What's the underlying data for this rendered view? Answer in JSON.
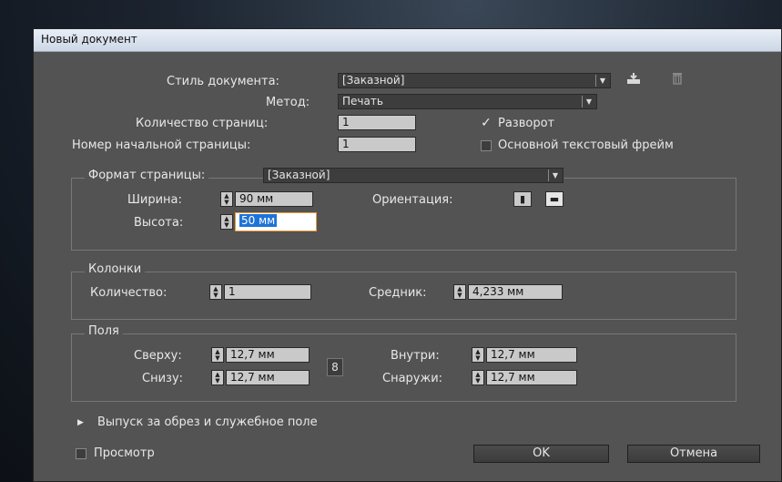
{
  "window": {
    "title": "Новый документ"
  },
  "doc": {
    "style_label": "Стиль документа:",
    "style_value": "[Заказной]",
    "method_label": "Метод:",
    "method_value": "Печать",
    "pages_label": "Количество страниц:",
    "pages_value": "1",
    "start_label": "Номер начальной страницы:",
    "start_value": "1",
    "spread_label": "Разворот",
    "spread_checked": true,
    "master_label": "Основной текстовый фрейм",
    "master_checked": false,
    "save_icon": "save-preset-icon",
    "delete_icon": "trash-icon"
  },
  "page_format": {
    "label": "Формат страницы:",
    "value": "[Заказной]",
    "width_label": "Ширина:",
    "width_value": "90 мм",
    "height_label": "Высота:",
    "height_value": "50 мм",
    "orient_label": "Ориентация:",
    "portrait_icon": "portrait-orientation-icon",
    "landscape_icon": "landscape-orientation-icon"
  },
  "columns": {
    "title": "Колонки",
    "count_label": "Количество:",
    "count_value": "1",
    "gutter_label": "Средник:",
    "gutter_value": "4,233 мм"
  },
  "margins": {
    "title": "Поля",
    "top_label": "Сверху:",
    "top_value": "12,7 мм",
    "bottom_label": "Снизу:",
    "bottom_value": "12,7 мм",
    "inside_label": "Внутри:",
    "inside_value": "12,7 мм",
    "outside_label": "Снаружи:",
    "outside_value": "12,7 мм",
    "link_icon": "chain-link-icon"
  },
  "bleed": {
    "label": "Выпуск за обрез и служебное поле"
  },
  "footer": {
    "preview_label": "Просмотр",
    "ok_label": "OK",
    "cancel_label": "Отмена"
  },
  "colors": {
    "dialog_bg": "#535353",
    "field_bg": "#c9c9c9",
    "focus": "#e89a3c",
    "selection": "#1e73d9"
  }
}
